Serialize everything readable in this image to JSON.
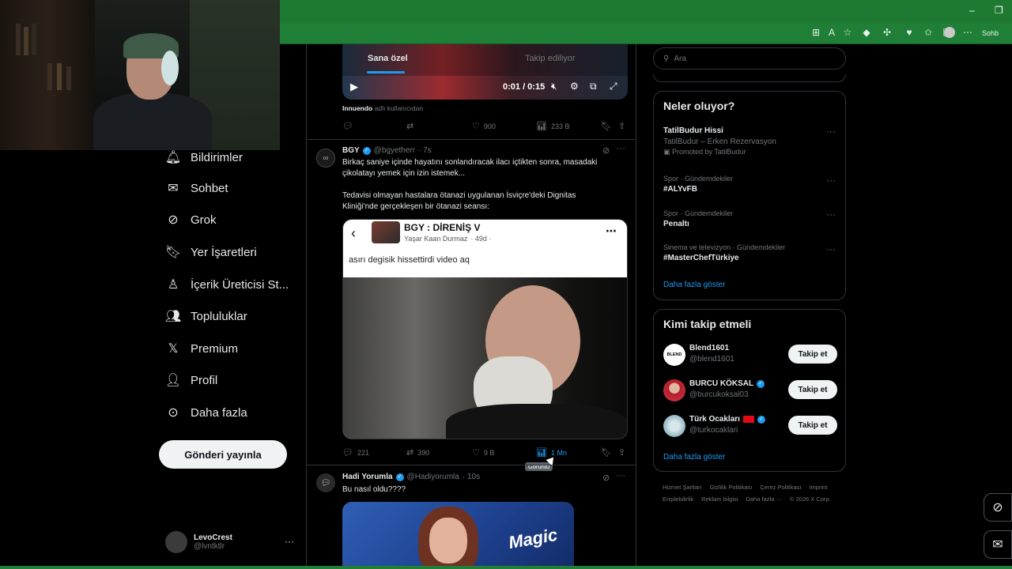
{
  "browser": {
    "profile_label": "Sohb"
  },
  "nav": {
    "items": [
      {
        "label": "Bildirimler",
        "icon": "bell-icon"
      },
      {
        "label": "Sohbet",
        "icon": "mail-icon"
      },
      {
        "label": "Grok",
        "icon": "grok-icon"
      },
      {
        "label": "Yer İşaretleri",
        "icon": "bookmark-icon"
      },
      {
        "label": "İçerik Üreticisi St...",
        "icon": "creator-studio-icon"
      },
      {
        "label": "Topluluklar",
        "icon": "communities-icon"
      },
      {
        "label": "Premium",
        "icon": "x-logo-icon"
      },
      {
        "label": "Profil",
        "icon": "profile-icon"
      },
      {
        "label": "Daha fazla",
        "icon": "more-circle-icon"
      }
    ],
    "post_button": "Gönderi yayınla",
    "account": {
      "name": "LevoCrest",
      "handle": "@lvntktlr"
    }
  },
  "feed": {
    "tabs": [
      {
        "label": "Sana özel",
        "active": true
      },
      {
        "label": "Takip ediliyor",
        "active": false
      }
    ],
    "video_controls": {
      "time": "0:01 / 0:15"
    },
    "prev_tweet": {
      "source_user": "Innuendo",
      "source_suffix": "adlı kullanıcıdan",
      "likes": "900",
      "views": "233 B"
    },
    "tweet1": {
      "name": "BGY",
      "handle": "@bgyetherr",
      "time": "· 7s",
      "text1": "Birkaç saniye içinde hayatını sonlandıracak ilacı içtikten sonra, masadaki",
      "text2": "çikolatayı yemek için izin istemek...",
      "text3": "Tedavisi olmayan hastalara ötanazi uygulanan İsviçre'deki Dignitas",
      "text4": "Kliniği'nde gerçekleşen bir ötanazi seansı:",
      "embed": {
        "title": "BGY : DİRENİŞ V",
        "author": "Yaşar Kaan Durmaz",
        "age": "· 49d ·",
        "text": "asırı degisik hissettirdi video aq"
      },
      "replies": "221",
      "reposts": "390",
      "likes": "9 B",
      "views": "1 Mn",
      "tooltip": "Görüntü"
    },
    "tweet2": {
      "name": "Hadi Yorumla",
      "handle": "@Hadiyorumla",
      "time": "· 10s",
      "text": "Bu nasıl oldu????",
      "image_label": "Magic"
    }
  },
  "sidebar": {
    "search_placeholder": "Ara",
    "trends_title": "Neler oluyor?",
    "trends": [
      {
        "name": "TatilBudur Hissi",
        "sub": "TatilBudur – Erken Rezervasyon",
        "promo": "Promoted by TatilBudur"
      },
      {
        "meta": "Spor · Gündemdekiler",
        "name": "#ALYvFB"
      },
      {
        "meta": "Spor · Gündemdekiler",
        "name": "Penaltı"
      },
      {
        "meta": "Sinema ve televizyon · Gündemdekiler",
        "name": "#MasterChefTürkiye"
      }
    ],
    "show_more": "Daha fazla göster",
    "who_title": "Kimi takip etmeli",
    "who": [
      {
        "name": "Blend1601",
        "handle": "@blend1601",
        "avatar_text": "BLEND"
      },
      {
        "name": "BURCU KÖKSAL",
        "handle": "@burcukoksal03"
      },
      {
        "name": "Türk Ocakları",
        "handle": "@turkocaklari"
      }
    ],
    "follow_label": "Takip et",
    "footer": [
      "Hizmet Şartları",
      "Gizlilik Politikası",
      "Çerez Politikası",
      "Imprint",
      "Erişilebilirlik",
      "Reklam bilgisi",
      "Daha fazla ···",
      "© 2026 X Corp."
    ]
  },
  "colors": {
    "accent": "#1d9bf0",
    "browser_green": "#1f7f36"
  }
}
